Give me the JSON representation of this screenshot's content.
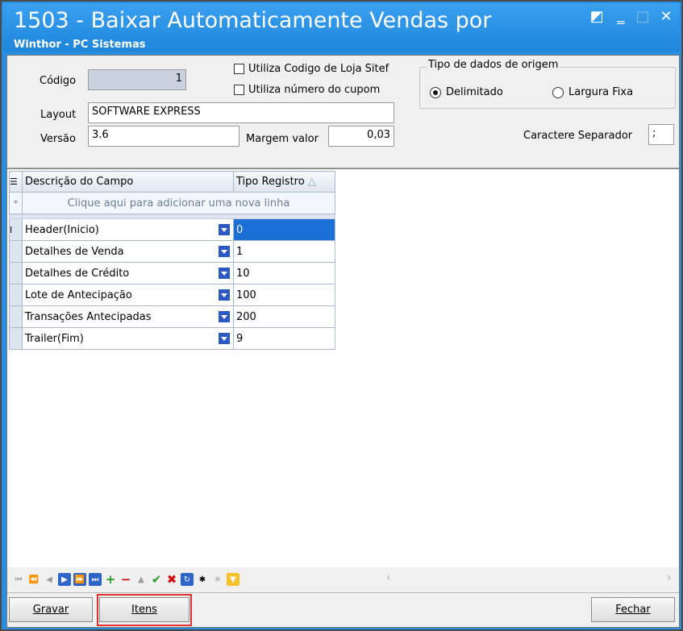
{
  "window": {
    "title": "1503 - Baixar Automaticamente Vendas por",
    "subtitle": "Winthor - PC Sistemas",
    "controls": {
      "restore": "◩",
      "minimize": "‗",
      "maximize": "□",
      "close": "✕"
    }
  },
  "form": {
    "codigo_label": "Código",
    "codigo_value": "1",
    "layout_label": "Layout",
    "layout_value": "SOFTWARE EXPRESS",
    "versao_label": "Versão",
    "versao_value": "3.6",
    "margem_label": "Margem valor",
    "margem_value": "0,03",
    "utiliza_codigo_loja": "Utiliza Codigo de Loja Sitef",
    "utiliza_numero_cupom": "Utiliza número do cupom",
    "tipo_dados_title": "Tipo de dados de origem",
    "radio_delimitado": "Delimitado",
    "radio_largura": "Largura Fixa",
    "caractere_label": "Caractere Separador",
    "caractere_value": ";"
  },
  "grid": {
    "header_desc": "Descrição do Campo",
    "header_tipo": "Tipo Registro",
    "sort_arrow": "△",
    "new_row_indicator": "*",
    "new_row_text": "Clique aqui para adicionar uma nova linha",
    "current_indicator": "I",
    "rows": [
      {
        "desc": "Header(Inicio)",
        "tipo": "0"
      },
      {
        "desc": "Detalhes de Venda",
        "tipo": "1"
      },
      {
        "desc": "Detalhes de Crédito",
        "tipo": "10"
      },
      {
        "desc": "Lote de Antecipação",
        "tipo": "100"
      },
      {
        "desc": "Transações Antecipadas",
        "tipo": "200"
      },
      {
        "desc": "Trailer(Fim)",
        "tipo": "9"
      }
    ]
  },
  "buttons": {
    "gravar": "Gravar",
    "itens": "Itens",
    "fechar": "Fechar"
  }
}
